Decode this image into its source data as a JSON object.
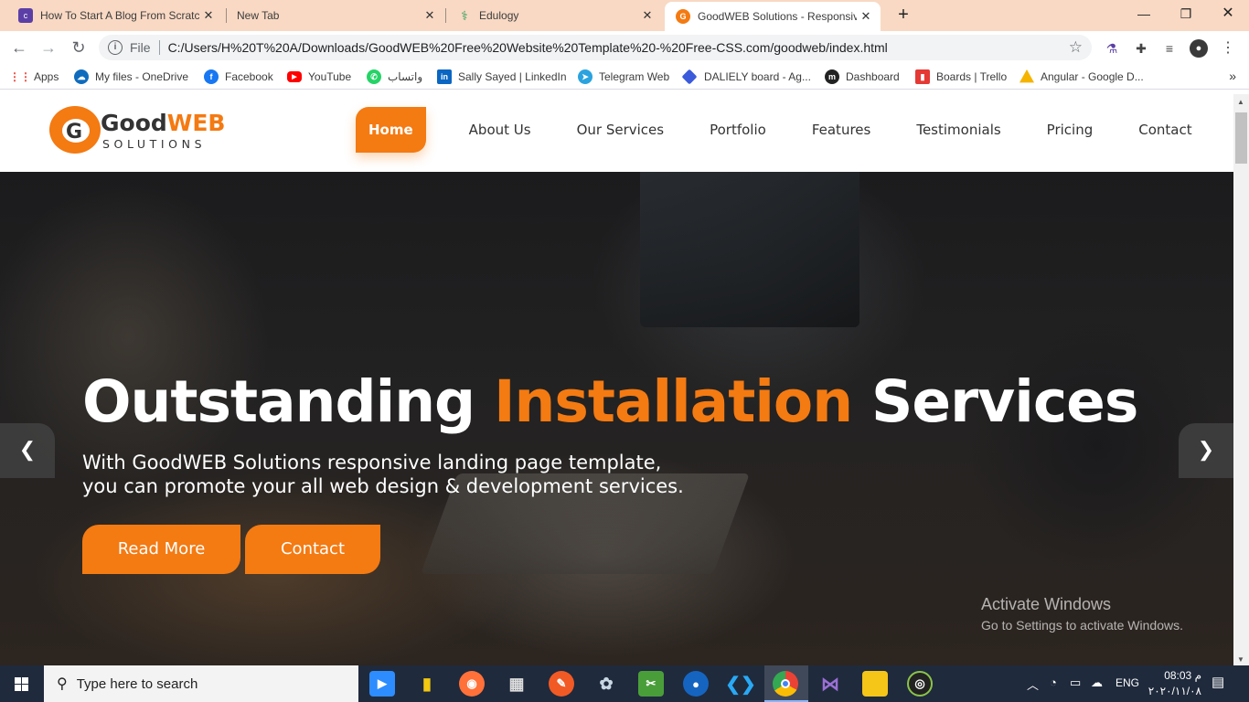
{
  "browser": {
    "tabs": [
      {
        "title": "How To Start A Blog From Scratch",
        "favicon": "colorlib-icon"
      },
      {
        "title": "New Tab",
        "favicon": ""
      },
      {
        "title": "Edulogy",
        "favicon": "edulogy-icon"
      },
      {
        "title": "GoodWEB Solutions - Responsive",
        "favicon": "goodweb-icon",
        "active": true
      }
    ],
    "address": {
      "scheme_label": "File",
      "url": "C:/Users/H%20T%20A/Downloads/GoodWEB%20Free%20Website%20Template%20-%20Free-CSS.com/goodweb/index.html"
    },
    "bookmarks": [
      {
        "label": "Apps",
        "icon": "apps-grid-icon",
        "color": "#e94235"
      },
      {
        "label": "My files - OneDrive",
        "icon": "onedrive-icon",
        "color": "#0f6cbd"
      },
      {
        "label": "Facebook",
        "icon": "facebook-icon",
        "color": "#1877f2"
      },
      {
        "label": "YouTube",
        "icon": "youtube-icon",
        "color": "#ff0000"
      },
      {
        "label": "واتساب",
        "icon": "whatsapp-icon",
        "color": "#25d366"
      },
      {
        "label": "Sally Sayed | LinkedIn",
        "icon": "linkedin-icon",
        "color": "#0a66c2"
      },
      {
        "label": "Telegram Web",
        "icon": "telegram-icon",
        "color": "#2aa3df"
      },
      {
        "label": "DALIELY board - Ag...",
        "icon": "board-icon",
        "color": "#3b5bdb"
      },
      {
        "label": "Dashboard",
        "icon": "dashboard-icon",
        "color": "#222222"
      },
      {
        "label": "Boards | Trello",
        "icon": "trello-icon",
        "color": "#e53935"
      },
      {
        "label": "Angular - Google D...",
        "icon": "google-drive-icon",
        "color": "#f4b400"
      }
    ]
  },
  "site": {
    "logo": {
      "word1": "Good",
      "word2": "WEB",
      "sub": "SOLUTIONS"
    },
    "nav": [
      "Home",
      "About Us",
      "Our Services",
      "Portfolio",
      "Features",
      "Testimonials",
      "Pricing",
      "Contact"
    ],
    "hero": {
      "title_part1": "Outstanding",
      "title_highlight": "Installation",
      "title_part2": "Services",
      "subtitle_line1": "With GoodWEB Solutions responsive landing page template,",
      "subtitle_line2": "you can promote your all web design & development services.",
      "buttons": [
        "Read More",
        "Contact"
      ]
    }
  },
  "watermark": {
    "line1": "Activate Windows",
    "line2": "Go to Settings to activate Windows."
  },
  "taskbar": {
    "search_placeholder": "Type here to search",
    "tray": {
      "lang": "ENG",
      "time": "08:03 م",
      "date": "٢٠٢٠/١١/٠٨"
    }
  },
  "colors": {
    "accent": "#f47a12",
    "tabstrip": "#f9d9c4",
    "taskbar": "#1f2a3c"
  }
}
